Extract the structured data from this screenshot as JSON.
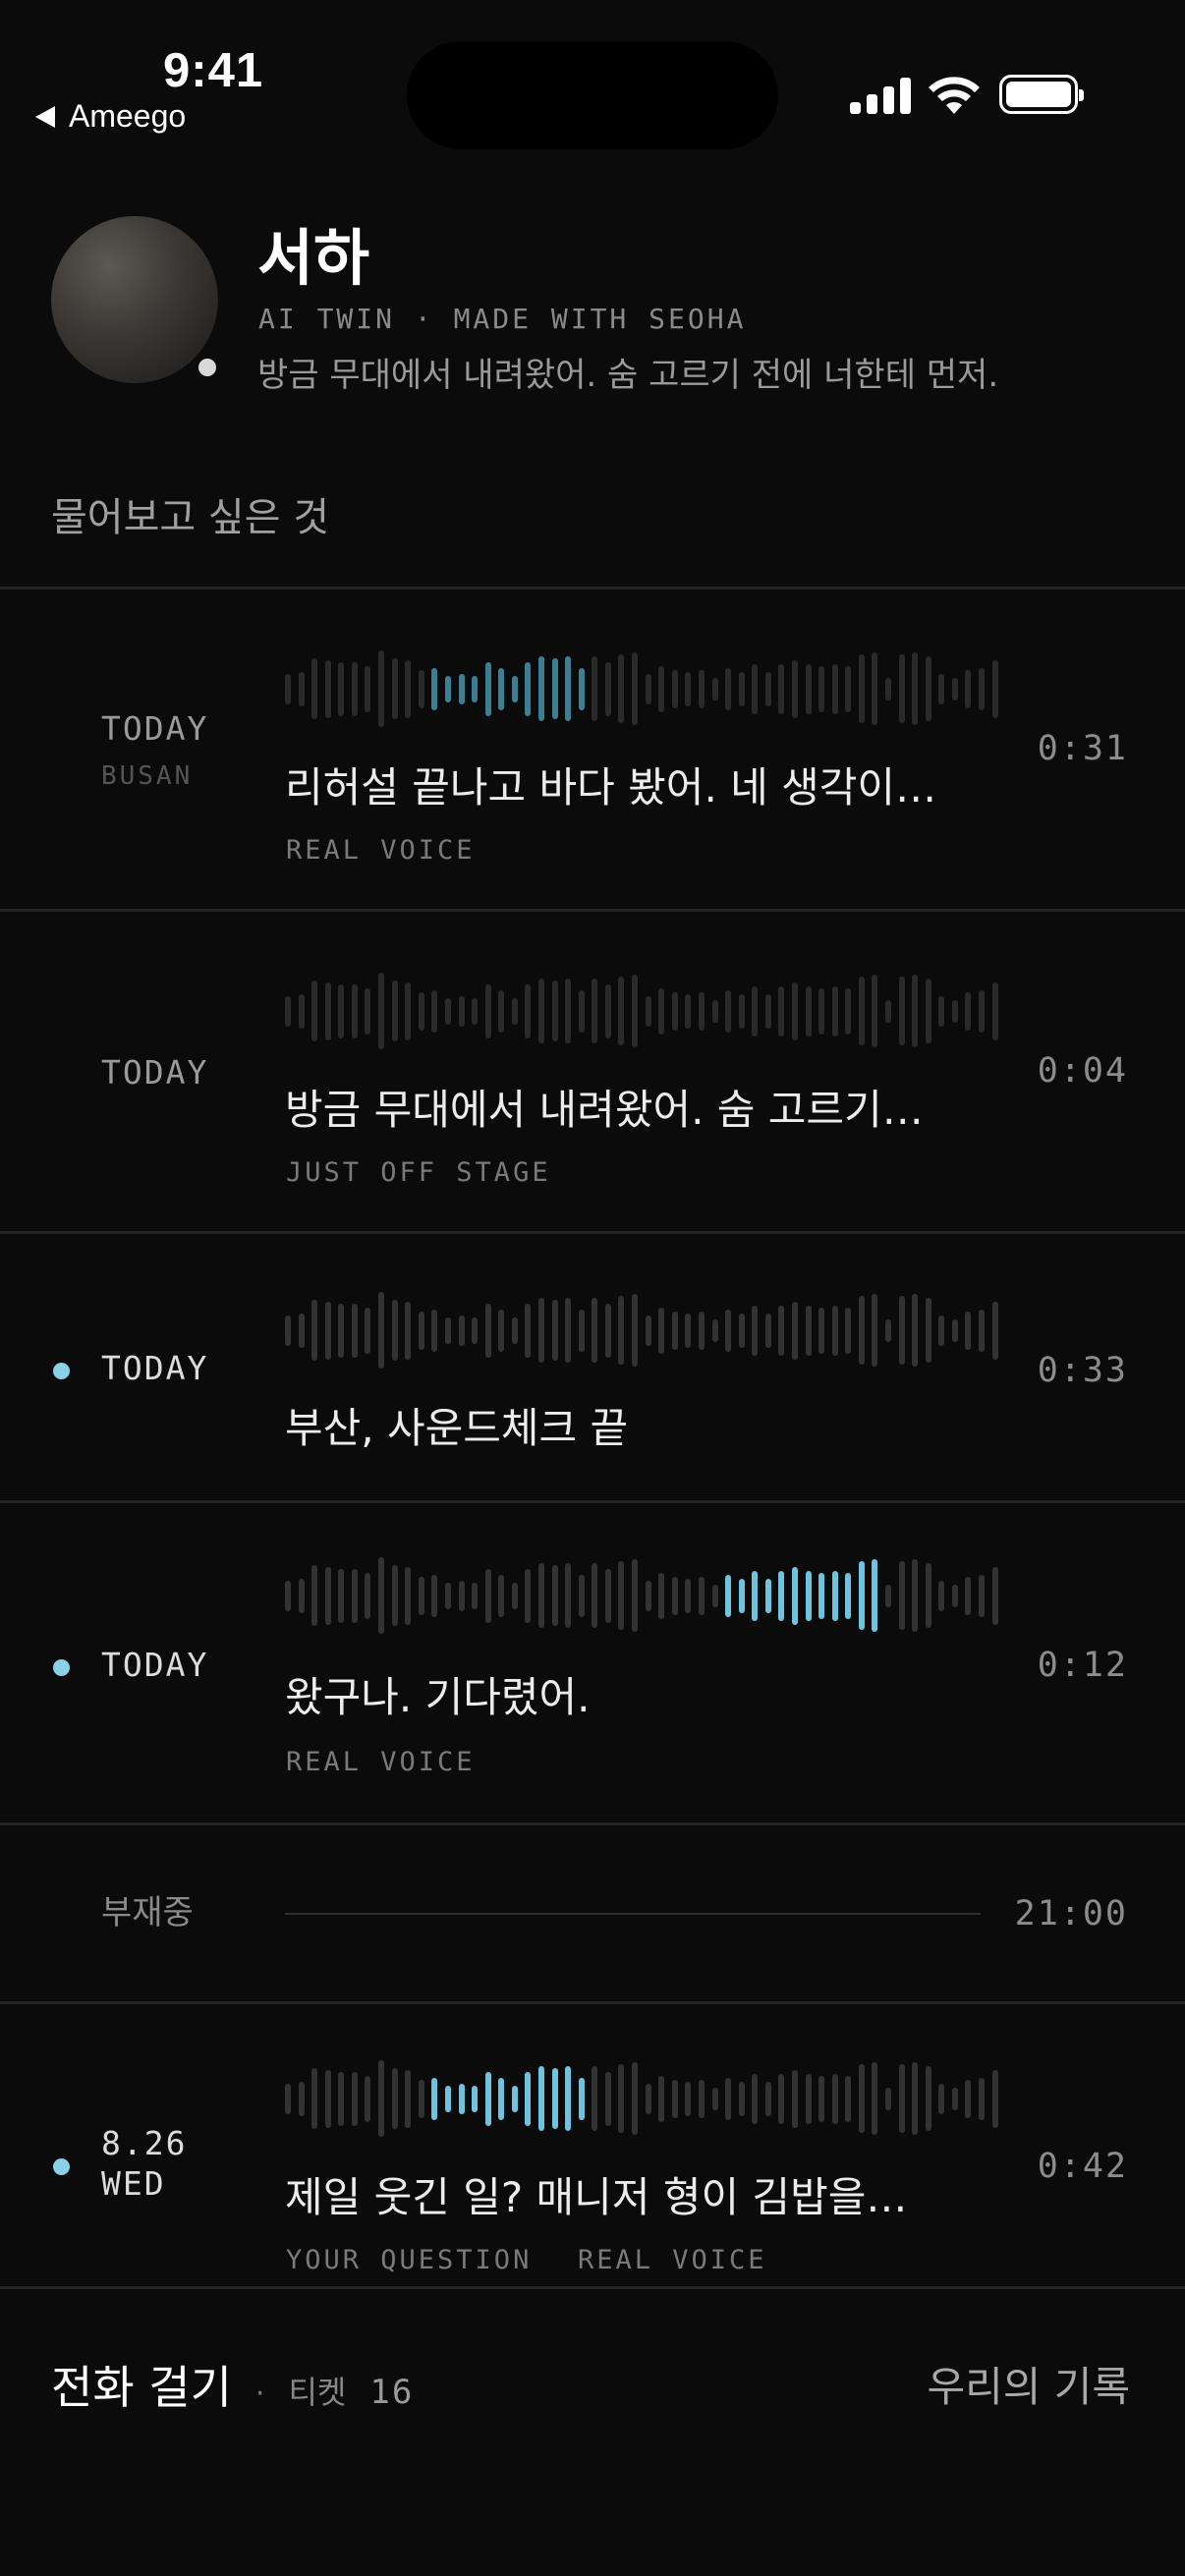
{
  "status_bar": {
    "time": "9:41",
    "back_label": "Ameego"
  },
  "profile": {
    "name": "서하",
    "subtitle": "AI TWIN · MADE WITH SEOHA",
    "status": "방금 무대에서 내려왔어. 숨 고르기 전에 너한테 먼저."
  },
  "ask_prompt": "물어보고 싶은 것",
  "messages": [
    {
      "date": "TODAY",
      "location": "BUSAN",
      "text": "리허설 끝나고 바다 봤어. 네 생각이…",
      "tag": "REAL VOICE",
      "duration": "0:31",
      "unread": false,
      "progress": 0.42
    },
    {
      "date": "TODAY",
      "text": "방금 무대에서 내려왔어. 숨 고르기…",
      "tag": "JUST OFF STAGE",
      "duration": "0:04",
      "unread": false,
      "progress": 0
    },
    {
      "date": "TODAY",
      "text": "부산, 사운드체크 끝",
      "duration": "0:33",
      "unread": true,
      "progress": 0
    },
    {
      "date": "TODAY",
      "text": "왔구나. 기다렸어.",
      "tag": "REAL VOICE",
      "duration": "0:12",
      "unread": true,
      "progress": 0.6
    },
    {
      "absent_label": "부재중",
      "absent_time": "21:00"
    },
    {
      "date_line1": "8.26",
      "date_line2": "WED",
      "text": "제일 웃긴 일? 매니저 형이 김밥을…",
      "tag": "YOUR QUESTION",
      "tag2": "REAL VOICE",
      "duration": "0:42",
      "unread": true,
      "progress": 0.42
    }
  ],
  "bottom": {
    "call_label": "전화 걸기",
    "separator": "·",
    "ticket_label": "티켓",
    "ticket_count": "16",
    "records_label": "우리의 기록"
  },
  "colors": {
    "accent": "#6ec3de",
    "accent_dim": "#3d7f92",
    "bar_idle": "#2a2a2a",
    "bar_idle_bright": "#333333"
  }
}
